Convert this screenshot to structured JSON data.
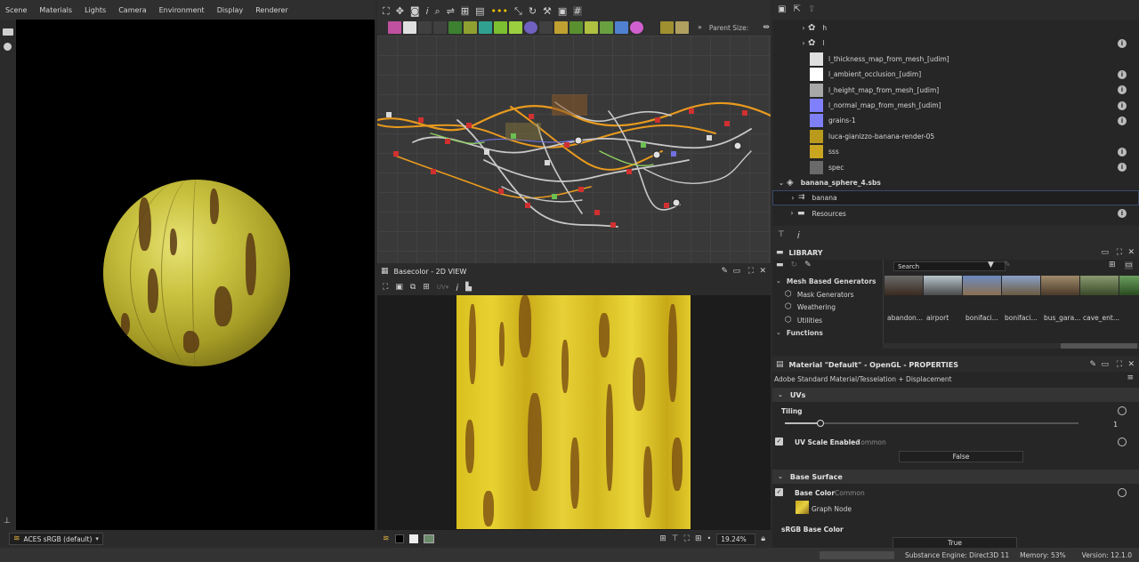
{
  "viewport3d": {
    "menu": [
      "Scene",
      "Materials",
      "Lights",
      "Camera",
      "Environment",
      "Display",
      "Renderer"
    ],
    "colorspace": "ACES sRGB (default)"
  },
  "graph": {
    "parent_size_label": "Parent Size:"
  },
  "view2d": {
    "title": "Basecolor - 2D VIEW",
    "zoom": "19.24%"
  },
  "explorer": {
    "items": [
      {
        "label": "h",
        "type": "graph",
        "has_info": false
      },
      {
        "label": "l",
        "type": "graph",
        "has_info": true
      },
      {
        "label": "l_thickness_map_from_mesh_[udim]",
        "type": "bitmap",
        "thumb": "#e0e0e0",
        "has_info": false
      },
      {
        "label": "l_ambient_occlusion_[udim]",
        "type": "bitmap",
        "thumb": "#ffffff",
        "has_info": true
      },
      {
        "label": "l_height_map_from_mesh_[udim]",
        "type": "bitmap",
        "thumb": "#a8a8a8",
        "has_info": true
      },
      {
        "label": "l_normal_map_from_mesh_[udim]",
        "type": "bitmap",
        "thumb": "#8080ff",
        "has_info": true
      },
      {
        "label": "grains-1",
        "type": "bitmap",
        "thumb": "#7f7ff5",
        "has_info": true
      },
      {
        "label": "luca-gianizzo-banana-render-05",
        "type": "bitmap",
        "thumb": "#b99a1c",
        "has_info": false
      },
      {
        "label": "sss",
        "type": "bitmap",
        "thumb": "#c9a520",
        "has_info": true
      },
      {
        "label": "spec",
        "type": "bitmap",
        "thumb": "#6a6a6a",
        "has_info": true
      }
    ],
    "package": "banana_sphere_4.sbs",
    "package_items": [
      {
        "label": "banana",
        "selected": true
      },
      {
        "label": "Resources",
        "selected": false
      }
    ]
  },
  "library": {
    "title": "LIBRARY",
    "search_placeholder": "Search",
    "categories": [
      {
        "label": "Mesh Based Generators",
        "bold": true
      },
      {
        "label": "Mask Generators",
        "bold": false
      },
      {
        "label": "Weathering",
        "bold": false
      },
      {
        "label": "Utilities",
        "bold": false
      },
      {
        "label": "Functions",
        "bold": true
      }
    ],
    "environments": [
      "abandon...",
      "airport",
      "bonifaci...",
      "bonifaci...",
      "bus_gara...",
      "cave_ent..."
    ]
  },
  "properties": {
    "title": "Material \"Default\" - OpenGL - PROPERTIES",
    "shader": "Adobe Standard Material/Tesselation + Displacement",
    "sections": {
      "uvs": "UVs",
      "base_surface": "Base Surface"
    },
    "tiling_label": "Tiling",
    "tiling_value": "1",
    "tiling_fraction": 0.12,
    "uv_scale_label": "UV Scale Enabled",
    "uv_scale_tag": "Common",
    "uv_scale_value": "False",
    "base_color_label": "Base Color",
    "base_color_tag": "Common",
    "base_color_source": "Graph Node",
    "srgb_label": "sRGB Base Color",
    "srgb_value": "True"
  },
  "status": {
    "engine": "Substance Engine: Direct3D 11",
    "memory": "Memory: 53%",
    "version": "Version: 12.1.0"
  }
}
